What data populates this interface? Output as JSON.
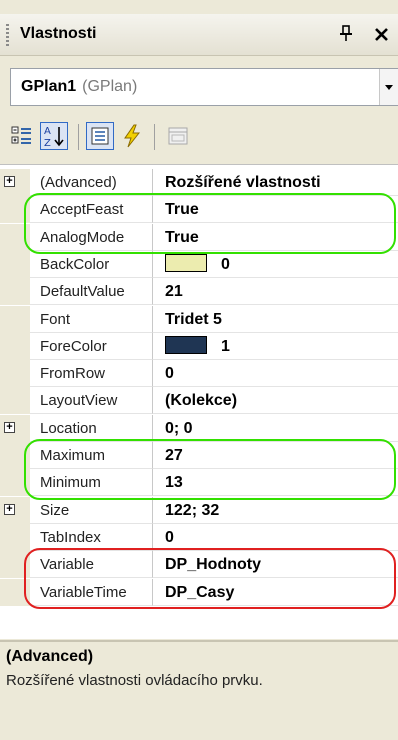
{
  "window": {
    "title": "Vlastnosti",
    "pin_glyph": "†",
    "close_glyph": "✕"
  },
  "selector": {
    "name": "GPlan1",
    "type": "(GPlan)"
  },
  "toolbar": {
    "buttons": [
      {
        "icon": "categorized-icon",
        "active": false
      },
      {
        "icon": "alphabetical-icon",
        "active": true
      },
      {
        "icon": "properties-icon",
        "active": true
      },
      {
        "icon": "events-icon",
        "active": false
      },
      {
        "icon": "property-pages-icon",
        "active": false
      }
    ]
  },
  "properties": [
    {
      "name": "(Advanced)",
      "value": "Rozšířené vlastnosti",
      "expandable": true
    },
    {
      "name": "AcceptFeast",
      "value": "True"
    },
    {
      "name": "AnalogMode",
      "value": "True"
    },
    {
      "name": "BackColor",
      "value": "0",
      "swatch": "#ececaf"
    },
    {
      "name": "DefaultValue",
      "value": "21"
    },
    {
      "name": "Font",
      "value": "Tridet 5"
    },
    {
      "name": "ForeColor",
      "value": "1",
      "swatch": "#1f3553"
    },
    {
      "name": "FromRow",
      "value": "0"
    },
    {
      "name": "LayoutView",
      "value": "(Kolekce)"
    },
    {
      "name": "Location",
      "value": "0; 0",
      "expandable": true
    },
    {
      "name": "Maximum",
      "value": "27"
    },
    {
      "name": "Minimum",
      "value": "13"
    },
    {
      "name": "Size",
      "value": "122; 32",
      "expandable": true
    },
    {
      "name": "TabIndex",
      "value": "0"
    },
    {
      "name": "Variable",
      "value": "DP_Hodnoty"
    },
    {
      "name": "VariableTime",
      "value": "DP_Casy"
    }
  ],
  "description": {
    "title": "(Advanced)",
    "text": "Rozšířené vlastnosti ovládacího prvku."
  },
  "colors": {
    "highlight_green": "#33e000",
    "highlight_red": "#e02020",
    "panel_bg": "#ece9d8"
  }
}
